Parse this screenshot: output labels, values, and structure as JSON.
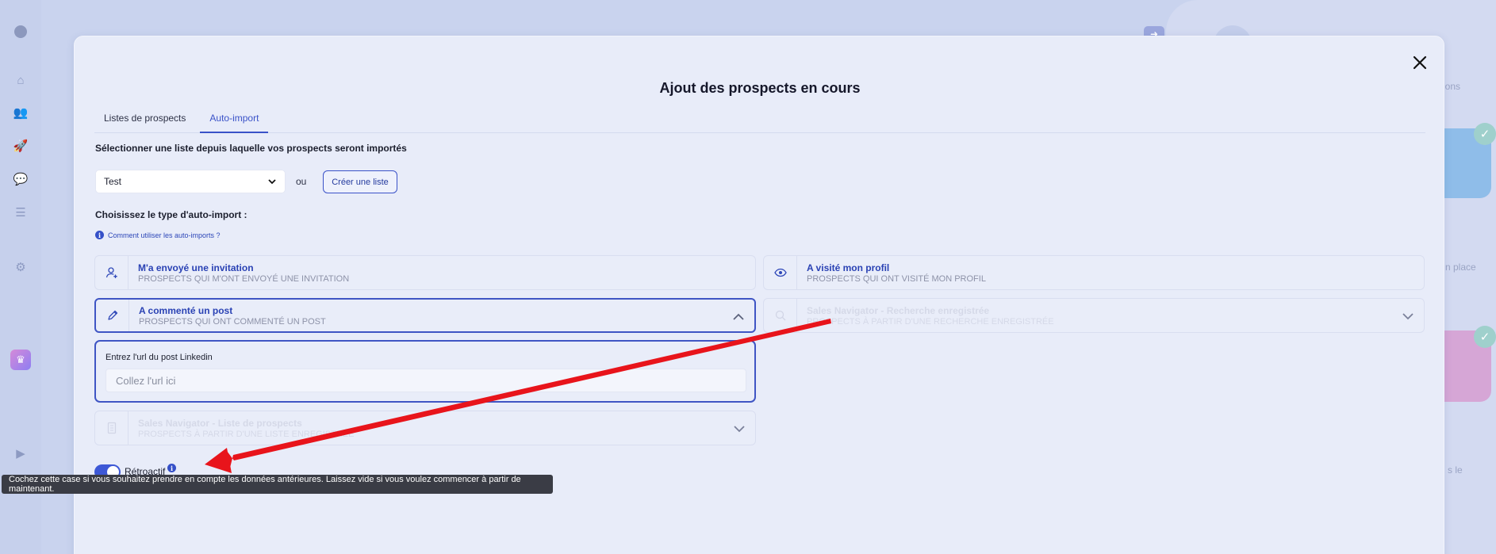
{
  "background": {
    "right_text_1": "sions",
    "right_text_2": "n place",
    "right_text_3": "s le"
  },
  "modal": {
    "title": "Ajout des prospects en cours",
    "tabs": [
      {
        "label": "Listes de prospects"
      },
      {
        "label": "Auto-import"
      }
    ],
    "select_prompt": "Sélectionner une liste depuis laquelle vos prospects seront importés",
    "list_select": {
      "value": "Test"
    },
    "or_text": "ou",
    "create_list_button": "Créer une liste",
    "type_prompt": "Choisissez le type d'auto-import :",
    "help_link": "Comment utiliser les auto-imports ?",
    "options": [
      {
        "title": "M'a envoyé une invitation",
        "subtitle": "PROSPECTS QUI M'ONT ENVOYÉ UNE INVITATION",
        "icon": "user-plus-icon"
      },
      {
        "title": "A visité mon profil",
        "subtitle": "PROSPECTS QUI ONT VISITÉ MON PROFIL",
        "icon": "eye-icon"
      },
      {
        "title": "A commenté un post",
        "subtitle": "PROSPECTS QUI ONT COMMENTÉ UN POST",
        "icon": "pencil-icon"
      },
      {
        "title": "Sales Navigator - Recherche enregistrée",
        "subtitle": "PROSPECTS À PARTIR D'UNE RECHERCHE ENREGISTRÉE",
        "icon": "search-icon"
      },
      {
        "title": "Sales Navigator - Liste de prospects",
        "subtitle": "PROSPECTS À PARTIR D'UNE LISTE ENREGISTRÉE",
        "icon": "document-icon"
      }
    ],
    "url_field": {
      "label": "Entrez l'url du post Linkedin",
      "placeholder": "Collez l'url ici",
      "value": ""
    },
    "retroactive": {
      "label": "Rétroactif",
      "enabled": true,
      "tooltip": "Cochez cette case si vous souhaitez prendre en compte les données antérieures. Laissez vide si vous voulez commencer à partir de maintenant."
    }
  },
  "colors": {
    "accent": "#3a52c8",
    "annotation_arrow": "#e8141b"
  }
}
